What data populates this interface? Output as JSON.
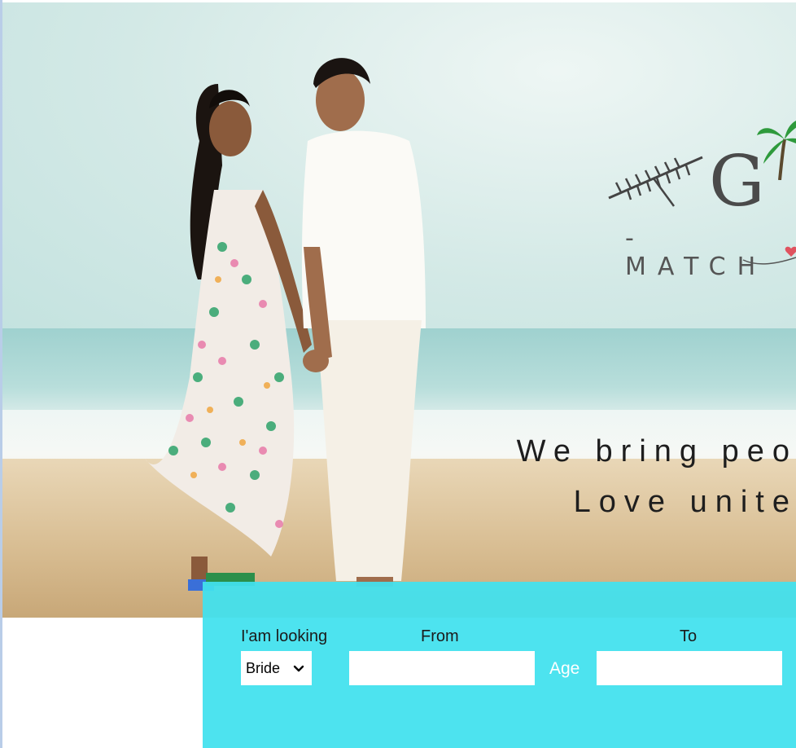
{
  "hero": {
    "logo_letters": "G",
    "logo_subtitle": "- MATCH",
    "tagline_line1": "We bring peo",
    "tagline_line2": "Love unite"
  },
  "search": {
    "looking_label": "I'am looking",
    "looking_value": "Bride",
    "from_label": "From",
    "to_label": "To",
    "age_label": "Age",
    "from_value": "",
    "to_value": ""
  },
  "colors": {
    "panel": "#42e1ee",
    "age_text": "#ffffff"
  }
}
